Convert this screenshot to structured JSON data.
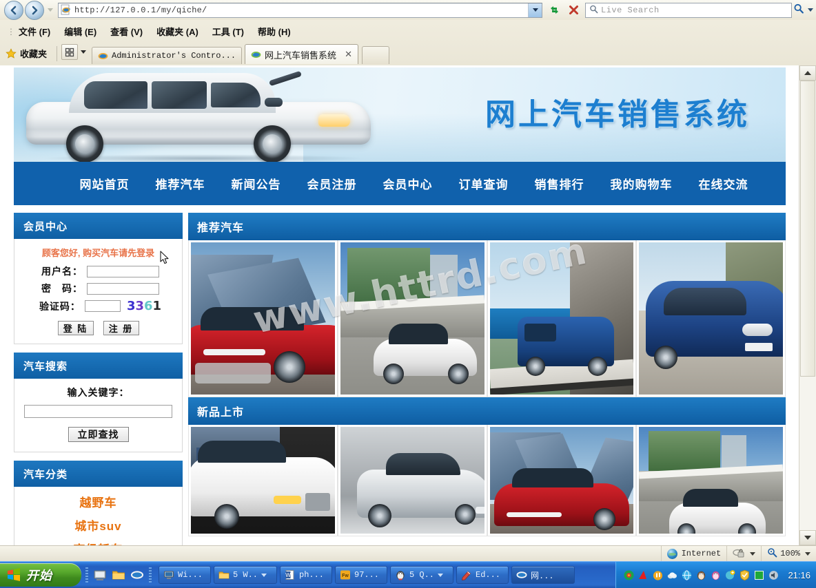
{
  "browser": {
    "url_prefix": "http://",
    "url_host": "127.0.0.1",
    "url_path": "/my/qiche/",
    "url_full": "http://127.0.0.1/my/qiche/",
    "search_placeholder": "Live Search",
    "menu": [
      "文件 (F)",
      "编辑 (E)",
      "查看 (V)",
      "收藏夹 (A)",
      "工具 (T)",
      "帮助 (H)"
    ],
    "favorites_label": "收藏夹",
    "tabs": [
      {
        "title": "Administrator's Contro...",
        "active": false,
        "mono": true
      },
      {
        "title": "网上汽车销售系统",
        "active": true,
        "mono": false,
        "close": "✕"
      }
    ]
  },
  "status": {
    "zone": "Internet",
    "zoom": "100%"
  },
  "site": {
    "banner_title": "网上汽车销售系统",
    "nav": [
      "网站首页",
      "推荐汽车",
      "新闻公告",
      "会员注册",
      "会员中心",
      "订单查询",
      "销售排行",
      "我的购物车",
      "在线交流"
    ]
  },
  "member_panel": {
    "title": "会员中心",
    "notice": "顾客您好, 购买汽车请先登录",
    "fields": [
      {
        "label": "用户名：",
        "value": "",
        "size": "wide"
      },
      {
        "label": "密　码：",
        "value": "",
        "size": "wide"
      },
      {
        "label": "验证码：",
        "value": "",
        "size": "small"
      }
    ],
    "captcha": [
      {
        "char": "3",
        "color": "#3b2fd0"
      },
      {
        "char": "3",
        "color": "#6a39c8"
      },
      {
        "char": "6",
        "color": "#63c8c8"
      },
      {
        "char": "1",
        "color": "#2a2a2a"
      }
    ],
    "captcha_text": "3361",
    "login_button": "登 陆",
    "register_button": "注 册"
  },
  "search_panel": {
    "title": "汽车搜索",
    "keyword_label": "输入关键字：",
    "keyword_value": "",
    "button": "立即查找"
  },
  "category_panel": {
    "title": "汽车分类",
    "items": [
      "越野车",
      "城市suv",
      "高级轿车"
    ]
  },
  "sections": [
    {
      "title": "推荐汽车",
      "cars": [
        {
          "alt": "red-sports-car",
          "style": "red-audi"
        },
        {
          "alt": "white-hatchback",
          "style": "white-alfa"
        },
        {
          "alt": "blue-van-coast-road",
          "style": "blue-van"
        },
        {
          "alt": "blue-compact-mpv",
          "style": "blue-mpv"
        }
      ]
    },
    {
      "title": "新品上市",
      "cars": [
        {
          "alt": "white-sedan-showroom",
          "style": "white-sedan"
        },
        {
          "alt": "silver-coupe-studio",
          "style": "silver-coupe"
        },
        {
          "alt": "red-sports-car",
          "style": "red-audi"
        },
        {
          "alt": "white-hatchback",
          "style": "white-alfa"
        }
      ]
    }
  ],
  "watermark": "www.httrd.com",
  "theme": {
    "nav_blue": "#1061ac",
    "header_blue": "#0f5fa4",
    "notice_orange": "#e8744a",
    "category_orange": "#e8720f",
    "banner_title_blue": "#1d7fd0"
  },
  "taskbar": {
    "start_label": "开始",
    "clock": "21:16",
    "tasks": [
      {
        "label": "Wi...",
        "icon": "computer-icon",
        "caret": false
      },
      {
        "label": "5 W..",
        "icon": "folder-icon",
        "caret": true
      },
      {
        "label": "ph...",
        "icon": "word-icon",
        "caret": false
      },
      {
        "label": "97...",
        "icon": "fw-icon",
        "caret": false
      },
      {
        "label": "5 Q..",
        "icon": "qq-icon",
        "caret": true
      },
      {
        "label": "Ed...",
        "icon": "editplus-icon",
        "caret": false
      },
      {
        "label": "网...",
        "icon": "ie-icon",
        "caret": false
      }
    ]
  }
}
